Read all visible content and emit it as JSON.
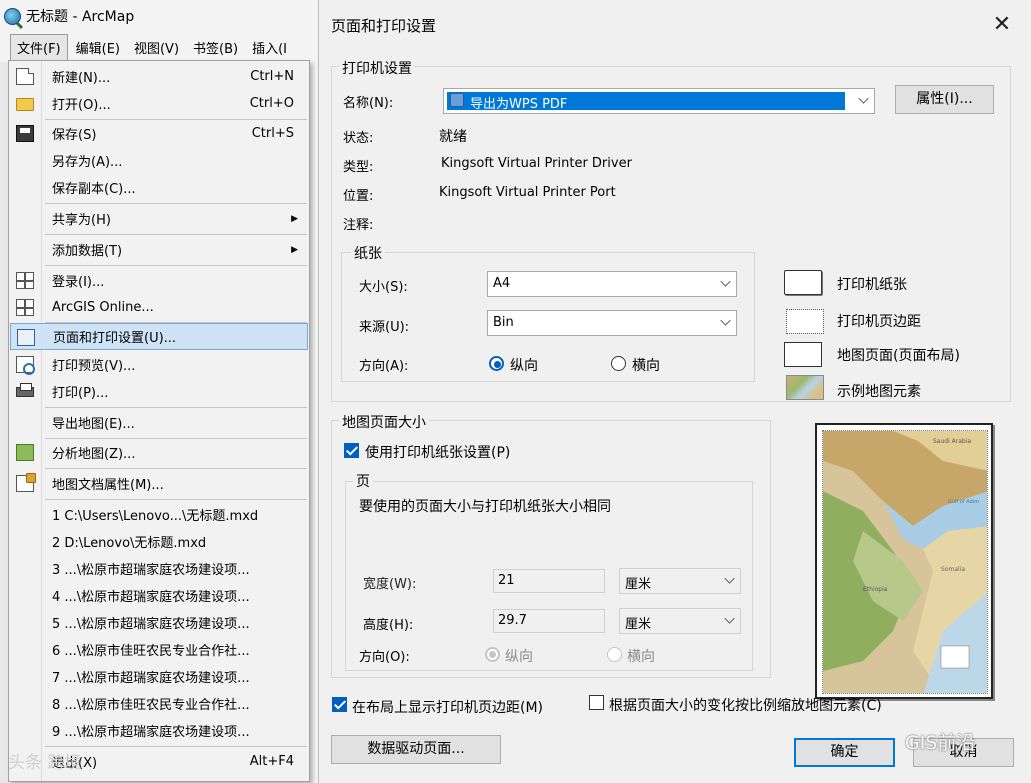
{
  "app": {
    "window_title": "无标题 - ArcMap",
    "menubar": [
      "文件(F)",
      "编辑(E)",
      "视图(V)",
      "书签(B)",
      "插入(I"
    ]
  },
  "file_menu": {
    "items": [
      {
        "label": "新建(N)...",
        "shortcut": "Ctrl+N",
        "icon": "new-document-icon"
      },
      {
        "label": "打开(O)...",
        "shortcut": "Ctrl+O",
        "icon": "open-folder-icon"
      },
      {
        "label": "保存(S)",
        "shortcut": "Ctrl+S",
        "icon": "save-icon"
      },
      {
        "label": "另存为(A)..."
      },
      {
        "label": "保存副本(C)..."
      },
      {
        "label": "共享为(H)",
        "submenu": true
      },
      {
        "label": "添加数据(T)",
        "submenu": true
      },
      {
        "label": "登录(I)...",
        "icon": "sign-in-icon"
      },
      {
        "label": "ArcGIS Online...",
        "icon": "arcgis-online-icon"
      },
      {
        "label": "页面和打印设置(U)...",
        "icon": "page-setup-icon",
        "highlighted": true
      },
      {
        "label": "打印预览(V)...",
        "icon": "print-preview-icon"
      },
      {
        "label": "打印(P)...",
        "icon": "print-icon"
      },
      {
        "label": "导出地图(E)..."
      },
      {
        "label": "分析地图(Z)...",
        "icon": "analyze-map-icon"
      },
      {
        "label": "地图文档属性(M)...",
        "icon": "document-properties-icon"
      },
      {
        "label": "1 C:\\Users\\Lenovo...\\无标题.mxd"
      },
      {
        "label": "2 D:\\Lenovo\\无标题.mxd"
      },
      {
        "label": "3 ...\\松原市超瑞家庭农场建设项..."
      },
      {
        "label": "4 ...\\松原市超瑞家庭农场建设项..."
      },
      {
        "label": "5 ...\\松原市超瑞家庭农场建设项..."
      },
      {
        "label": "6 ...\\松原市佳旺农民专业合作社..."
      },
      {
        "label": "7 ...\\松原市超瑞家庭农场建设项..."
      },
      {
        "label": "8 ...\\松原市佳旺农民专业合作社..."
      },
      {
        "label": "9 ...\\松原市超瑞家庭农场建设项..."
      },
      {
        "label": "退出(X)",
        "shortcut": "Alt+F4"
      }
    ]
  },
  "watermark_left": "头条 跨境",
  "dialog": {
    "title": "页面和打印设置",
    "printer": {
      "group_title": "打印机设置",
      "name_label": "名称(N):",
      "name_value": "导出为WPS PDF",
      "properties_button": "属性(I)...",
      "status_label": "状态:",
      "status_value": "就绪",
      "type_label": "类型:",
      "type_value": "Kingsoft Virtual Printer Driver",
      "location_label": "位置:",
      "location_value": "Kingsoft Virtual Printer Port",
      "comment_label": "注释:"
    },
    "paper": {
      "group_title": "纸张",
      "size_label": "大小(S):",
      "size_value": "A4",
      "source_label": "来源(U):",
      "source_value": "Bin",
      "orientation_label": "方向(A):",
      "portrait": "纵向",
      "landscape": "横向",
      "orientation_selected": "portrait"
    },
    "legend": {
      "printer_paper": "打印机纸张",
      "printer_margins": "打印机页边距",
      "map_page": "地图页面(页面布局)",
      "sample_elements": "示例地图元素"
    },
    "map_page_size": {
      "group_title": "地图页面大小",
      "use_printer_settings": "使用打印机纸张设置(P)",
      "use_printer_settings_checked": true,
      "page_group_title": "页",
      "page_note": "要使用的页面大小与打印机纸张大小相同",
      "width_label": "宽度(W):",
      "width_value": "21",
      "width_unit": "厘米",
      "height_label": "高度(H):",
      "height_value": "29.7",
      "height_unit": "厘米",
      "orientation_label": "方向(O):",
      "portrait": "纵向",
      "landscape": "横向",
      "orientation_selected": "portrait"
    },
    "show_margins": "在布局上显示打印机页边距(M)",
    "show_margins_checked": true,
    "scale_elements": "根据页面大小的变化按比例缩放地图元素(C)",
    "scale_elements_checked": false,
    "data_driven_button": "数据驱动页面...",
    "ok_button": "确定",
    "cancel_button": "取消",
    "preview_map_labels": [
      "Saudi Arabia",
      "Gulf of Aden",
      "Somalia",
      "Ethiopia"
    ],
    "watermark": "GIS前沿"
  }
}
